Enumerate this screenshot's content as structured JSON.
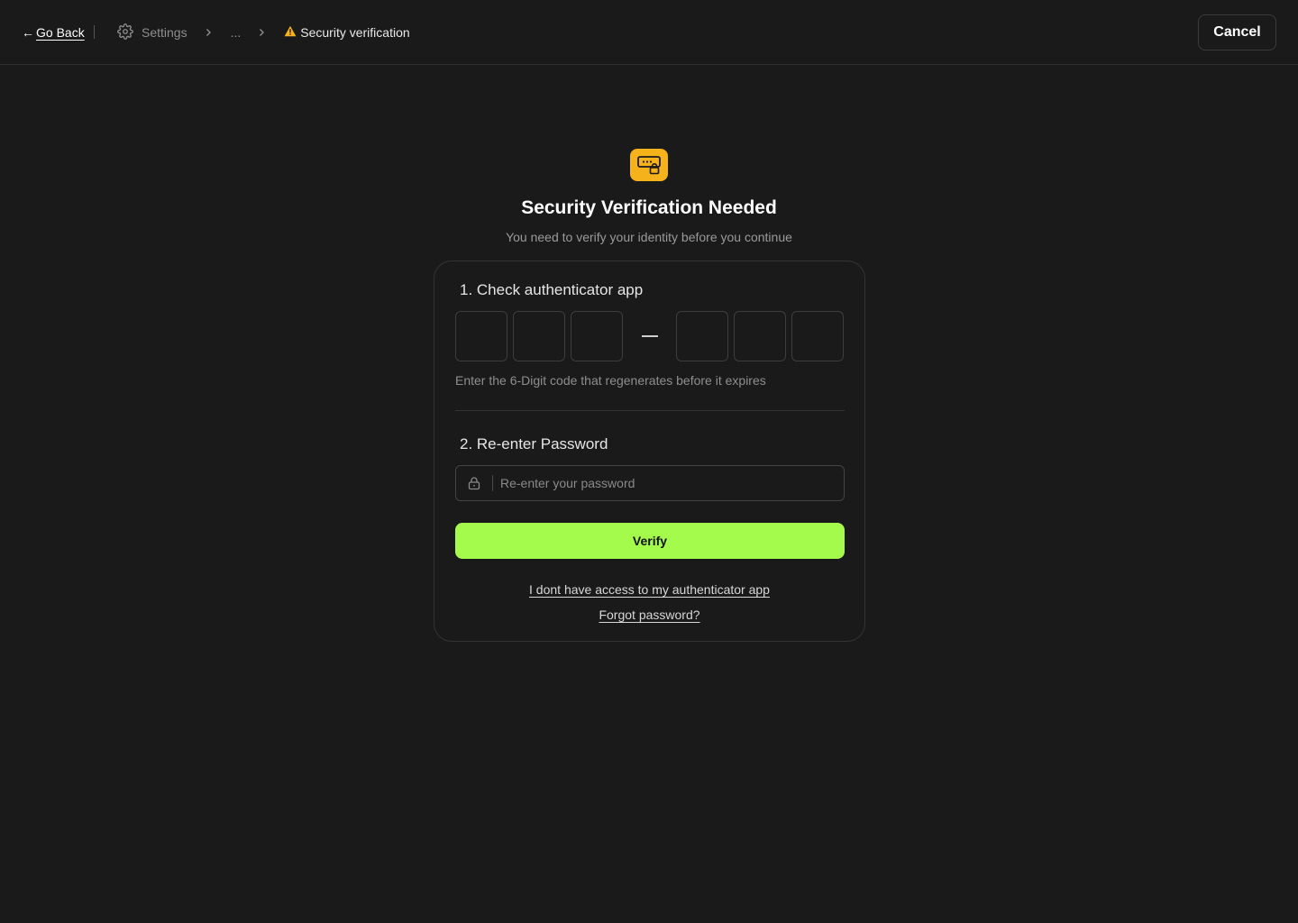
{
  "topbar": {
    "go_back_label": "Go Back",
    "breadcrumb": {
      "settings_label": "Settings",
      "ellipsis": "...",
      "current_label": "Security verification"
    },
    "cancel_label": "Cancel"
  },
  "header": {
    "title": "Security Verification Needed",
    "subtitle": "You need to verify your identity before you continue"
  },
  "step1": {
    "title": "1. Check authenticator app",
    "code_digits": [
      "",
      "",
      "",
      "",
      "",
      ""
    ],
    "hint": "Enter the 6-Digit code that regenerates before it expires"
  },
  "step2": {
    "title": "2. Re-enter Password",
    "password_placeholder": "Re-enter your password",
    "password_value": ""
  },
  "actions": {
    "verify_label": "Verify",
    "no_access_link": "I dont have access to my authenticator app",
    "forgot_link": "Forgot password?"
  },
  "colors": {
    "background": "#1a1a1a",
    "accent_green": "#a5fb4b",
    "warning_yellow": "#f5b21a"
  },
  "icons": {
    "back": "arrow-left-icon",
    "settings": "gear-icon",
    "chevron": "chevron-right-icon",
    "warning": "warning-triangle-icon",
    "hero": "password-lock-icon",
    "lock": "lock-icon"
  }
}
